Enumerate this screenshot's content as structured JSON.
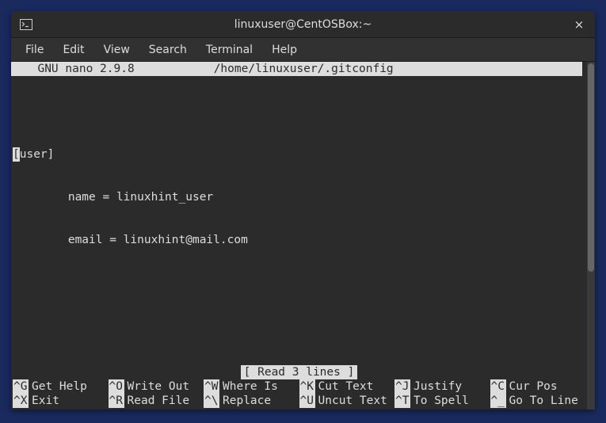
{
  "window": {
    "title": "linuxuser@CentOSBox:~"
  },
  "menubar": {
    "items": [
      "File",
      "Edit",
      "View",
      "Search",
      "Terminal",
      "Help"
    ]
  },
  "nano": {
    "version": "  GNU nano 2.9.8",
    "file": "/home/linuxuser/.gitconfig",
    "status": "[ Read 3 lines ]",
    "content": {
      "line1_bracket": "[",
      "line1_rest": "user]",
      "line2": "        name = linuxhint_user",
      "line3": "        email = linuxhint@mail.com"
    },
    "shortcuts": {
      "row1": [
        {
          "key": "^G",
          "label": "Get Help"
        },
        {
          "key": "^O",
          "label": "Write Out"
        },
        {
          "key": "^W",
          "label": "Where Is"
        },
        {
          "key": "^K",
          "label": "Cut Text"
        },
        {
          "key": "^J",
          "label": "Justify"
        },
        {
          "key": "^C",
          "label": "Cur Pos"
        }
      ],
      "row2": [
        {
          "key": "^X",
          "label": "Exit"
        },
        {
          "key": "^R",
          "label": "Read File"
        },
        {
          "key": "^\\",
          "label": "Replace"
        },
        {
          "key": "^U",
          "label": "Uncut Text"
        },
        {
          "key": "^T",
          "label": "To Spell"
        },
        {
          "key": "^_",
          "label": "Go To Line"
        }
      ]
    }
  }
}
